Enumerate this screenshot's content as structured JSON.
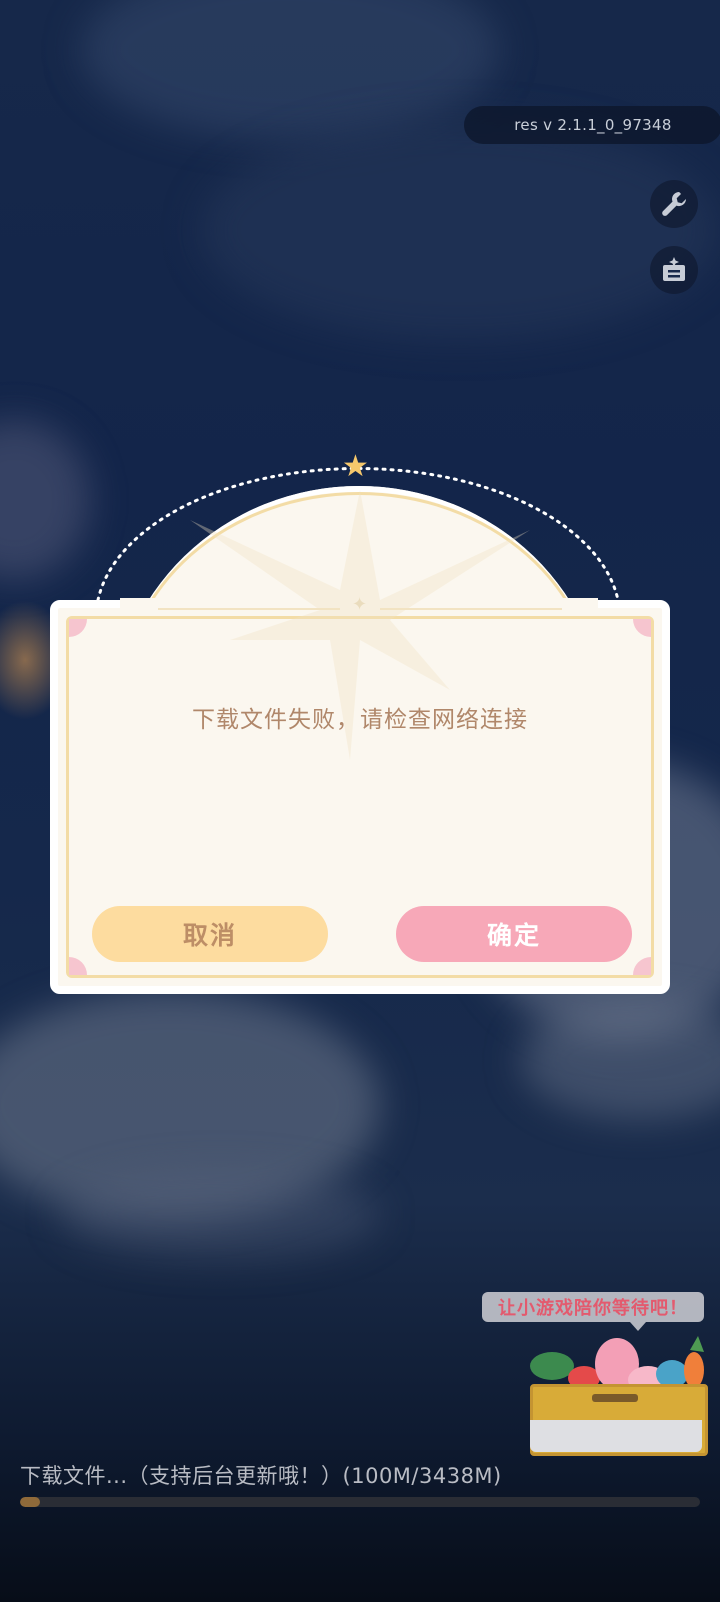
{
  "version_label": "res v 2.1.1_0_97348",
  "side_tools": [
    {
      "icon": "wrench-icon"
    },
    {
      "icon": "notice-board-icon"
    }
  ],
  "dialog": {
    "message": "下载文件失败，请检查网络连接",
    "cancel_label": "取消",
    "confirm_label": "确定"
  },
  "mini_game": {
    "prompt": "让小游戏陪你等待吧！"
  },
  "download": {
    "status_text": "下载文件...（支持后台更新哦！）(100M/3438M)",
    "downloaded_mb": 100,
    "total_mb": 3438,
    "progress_fraction": 0.029
  },
  "colors": {
    "cancel_bg": "#fddc9f",
    "confirm_bg": "#f7a8b8",
    "message_text": "#b0876a",
    "progress_fill": "#8f6a3a"
  }
}
